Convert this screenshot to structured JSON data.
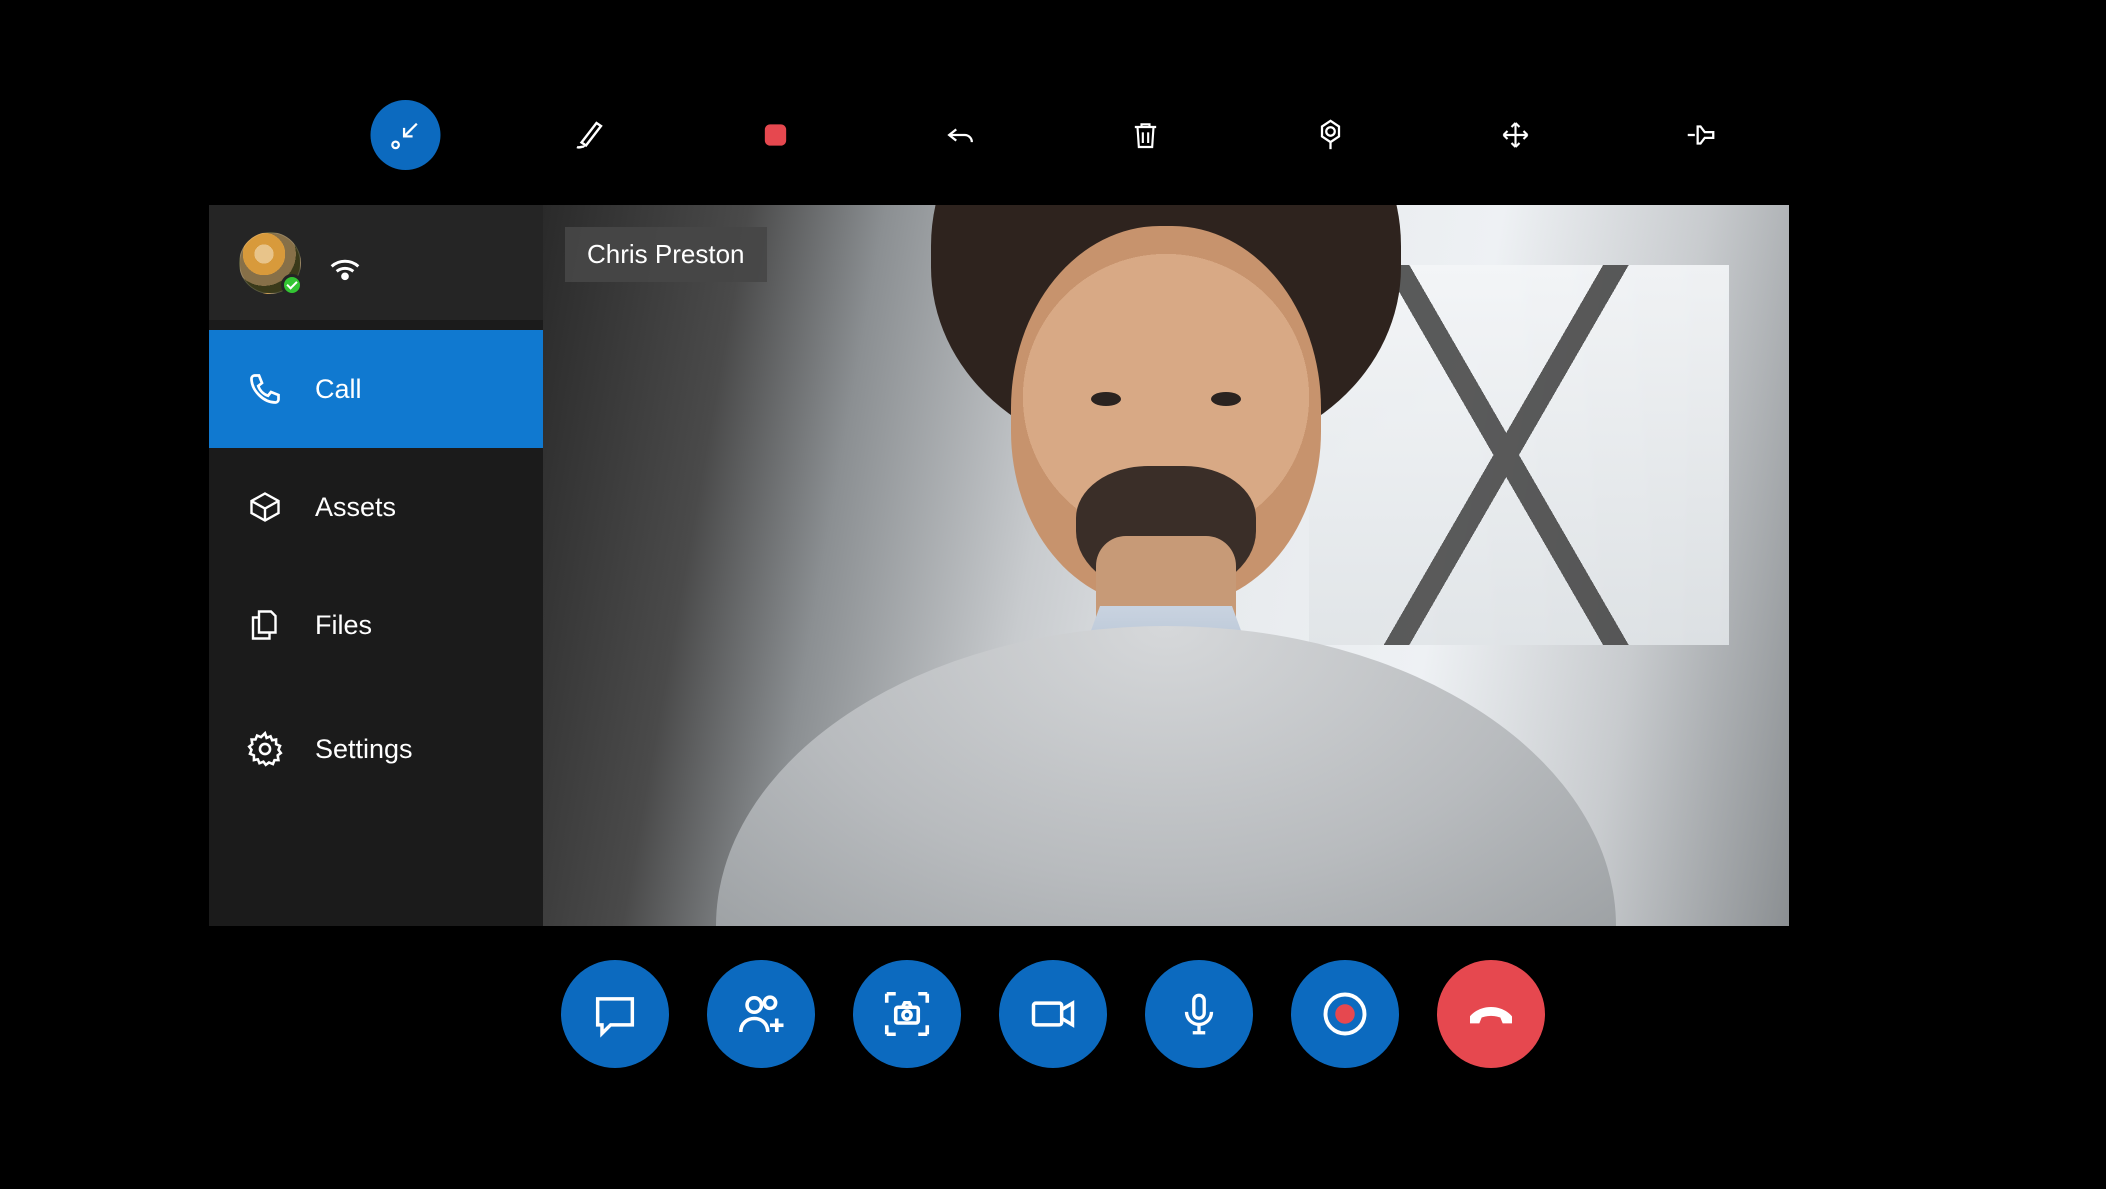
{
  "caller_name": "Chris Preston",
  "sidebar": {
    "items": [
      {
        "label": "Call"
      },
      {
        "label": "Assets"
      },
      {
        "label": "Files"
      },
      {
        "label": "Settings"
      }
    ]
  },
  "colors": {
    "accent": "#0C6ABF",
    "end_call": "#E6484F"
  },
  "top_toolbar": [
    "collapse-icon",
    "ink-icon",
    "stop-record-icon",
    "undo-icon",
    "delete-icon",
    "location-pin-icon",
    "move-icon",
    "pin-icon"
  ],
  "bottom_controls": [
    "chat-icon",
    "add-participant-icon",
    "capture-icon",
    "video-icon",
    "microphone-icon",
    "record-icon",
    "hangup-icon"
  ]
}
